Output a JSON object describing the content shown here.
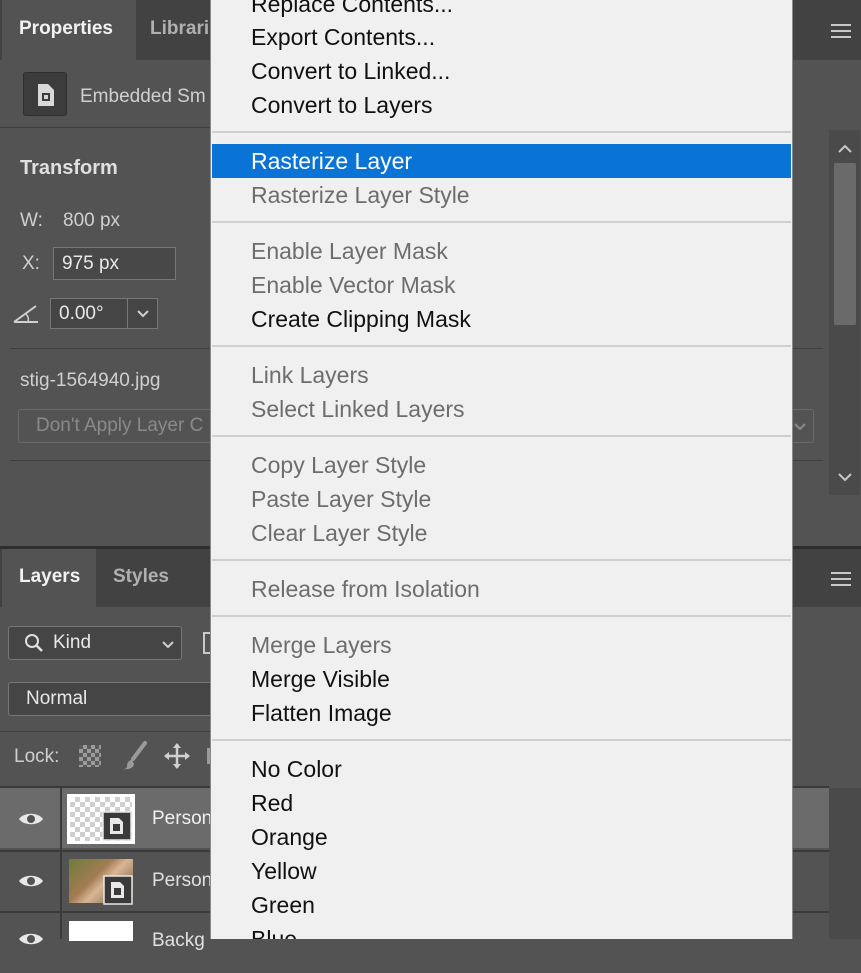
{
  "properties_panel": {
    "tabs": [
      {
        "label": "Properties",
        "active": true
      },
      {
        "label": "Librari",
        "active": false
      }
    ],
    "object_type": "Embedded Sm",
    "section_title": "Transform",
    "width_label": "W:",
    "width_value": "800 px",
    "x_label": "X:",
    "x_value": "975 px",
    "angle_value": "0.00°",
    "filename": "stig-1564940.jpg",
    "layer_comp_select": "Don't Apply Layer C"
  },
  "layers_panel": {
    "tabs": [
      {
        "label": "Layers",
        "active": true
      },
      {
        "label": "Styles",
        "active": false
      }
    ],
    "filter_kind": "Kind",
    "blend_mode": "Normal",
    "lock_label": "Lock:",
    "layers": [
      {
        "name": "Person",
        "visible": true,
        "selected": true
      },
      {
        "name": "Person",
        "visible": true,
        "selected": false
      },
      {
        "name": "Backg",
        "visible": true,
        "selected": false
      }
    ]
  },
  "context_menu": {
    "items": [
      {
        "label": "Replace Contents...",
        "enabled": true
      },
      {
        "label": "Export Contents...",
        "enabled": true
      },
      {
        "label": "Convert to Linked...",
        "enabled": true
      },
      {
        "label": "Convert to Layers",
        "enabled": true
      },
      {
        "label": "Rasterize Layer",
        "enabled": true,
        "highlighted": true
      },
      {
        "label": "Rasterize Layer Style",
        "enabled": false
      },
      {
        "label": "Enable Layer Mask",
        "enabled": false
      },
      {
        "label": "Enable Vector Mask",
        "enabled": false
      },
      {
        "label": "Create Clipping Mask",
        "enabled": true
      },
      {
        "label": "Link Layers",
        "enabled": false
      },
      {
        "label": "Select Linked Layers",
        "enabled": false
      },
      {
        "label": "Copy Layer Style",
        "enabled": false
      },
      {
        "label": "Paste Layer Style",
        "enabled": false
      },
      {
        "label": "Clear Layer Style",
        "enabled": false
      },
      {
        "label": "Release from Isolation",
        "enabled": false
      },
      {
        "label": "Merge Layers",
        "enabled": false
      },
      {
        "label": "Merge Visible",
        "enabled": true
      },
      {
        "label": "Flatten Image",
        "enabled": true
      },
      {
        "label": "No Color",
        "enabled": true
      },
      {
        "label": "Red",
        "enabled": true
      },
      {
        "label": "Orange",
        "enabled": true
      },
      {
        "label": "Yellow",
        "enabled": true
      },
      {
        "label": "Green",
        "enabled": true
      },
      {
        "label": "Blue",
        "enabled": true
      }
    ]
  },
  "colors": {
    "menu_highlight": "#0a74d6",
    "panel_bg": "#535353",
    "tabbar_bg": "#424242",
    "menu_bg": "#f0f0f0"
  }
}
